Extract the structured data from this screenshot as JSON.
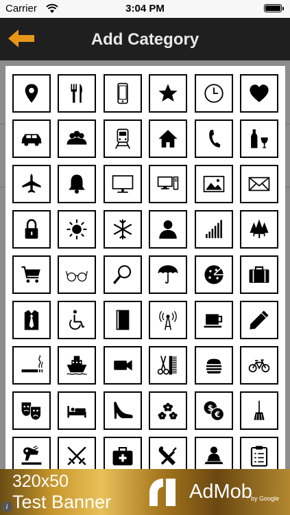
{
  "status_bar": {
    "carrier": "Carrier",
    "time": "3:04 PM",
    "battery_level": 1.0
  },
  "nav": {
    "title": "Add Category",
    "back_icon": "back-arrow-icon",
    "accent": "#e8961a"
  },
  "icon_rows": [
    [
      "location-pin-icon",
      "fork-knife-icon",
      "smartphone-icon",
      "star-icon",
      "clock-icon",
      "heart-icon"
    ],
    [
      "car-icon",
      "group-icon",
      "train-icon",
      "home-icon",
      "phone-handset-icon",
      "wine-icon"
    ],
    [
      "airplane-icon",
      "bell-icon",
      "monitor-icon",
      "desktop-computer-icon",
      "picture-icon",
      "envelope-icon"
    ],
    [
      "padlock-icon",
      "sun-icon",
      "snowflake-icon",
      "person-icon",
      "signal-bars-icon",
      "trees-icon"
    ],
    [
      "shopping-cart-icon",
      "glasses-icon",
      "magnifier-icon",
      "umbrella-icon",
      "pizza-icon",
      "briefcase-icon"
    ],
    [
      "shirt-tie-icon",
      "wheelchair-icon",
      "book-icon",
      "broadcast-tower-icon",
      "coffee-cup-icon",
      "pencil-icon"
    ],
    [
      "smoking-icon",
      "ship-icon",
      "video-camera-icon",
      "scissors-comb-icon",
      "burger-icon",
      "bicycle-icon"
    ],
    [
      "theater-masks-icon",
      "bed-icon",
      "high-heel-icon",
      "flowers-icon",
      "currency-coins-icon",
      "broom-icon"
    ],
    [
      "hair-dryer-icon",
      "crossed-swords-icon",
      "first-aid-kit-icon",
      "tools-icon",
      "user-laptop-icon",
      "clipboard-icon"
    ]
  ],
  "ad": {
    "line1": "320x50",
    "line2": "Test Banner",
    "brand": "AdMob",
    "by": "by Google",
    "info": "i"
  }
}
